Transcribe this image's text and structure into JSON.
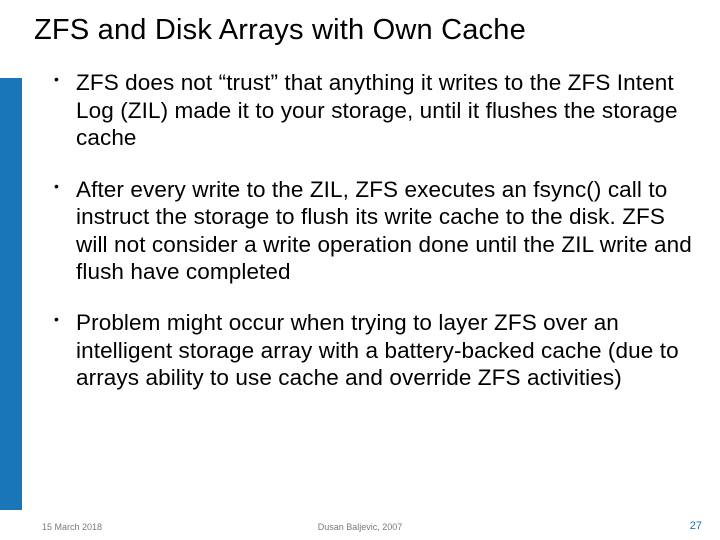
{
  "title": "ZFS and Disk Arrays with Own Cache",
  "bullets": [
    "ZFS does not “trust” that anything it writes to the ZFS Intent Log (ZIL) made it to your storage, until it flushes the storage cache",
    "After every write to the ZIL, ZFS executes an fsync() call to instruct the storage to flush its write cache to the disk. ZFS will not consider a write operation done until the ZIL write and flush have completed",
    "Problem might occur when trying to layer ZFS over an intelligent storage array with a battery-backed cache (due to arrays ability to use cache and override ZFS activities)"
  ],
  "footer": {
    "date": "15 March 2018",
    "author": "Dusan Baljevic, 2007",
    "page": "27"
  },
  "accent_color": "#1976b8"
}
